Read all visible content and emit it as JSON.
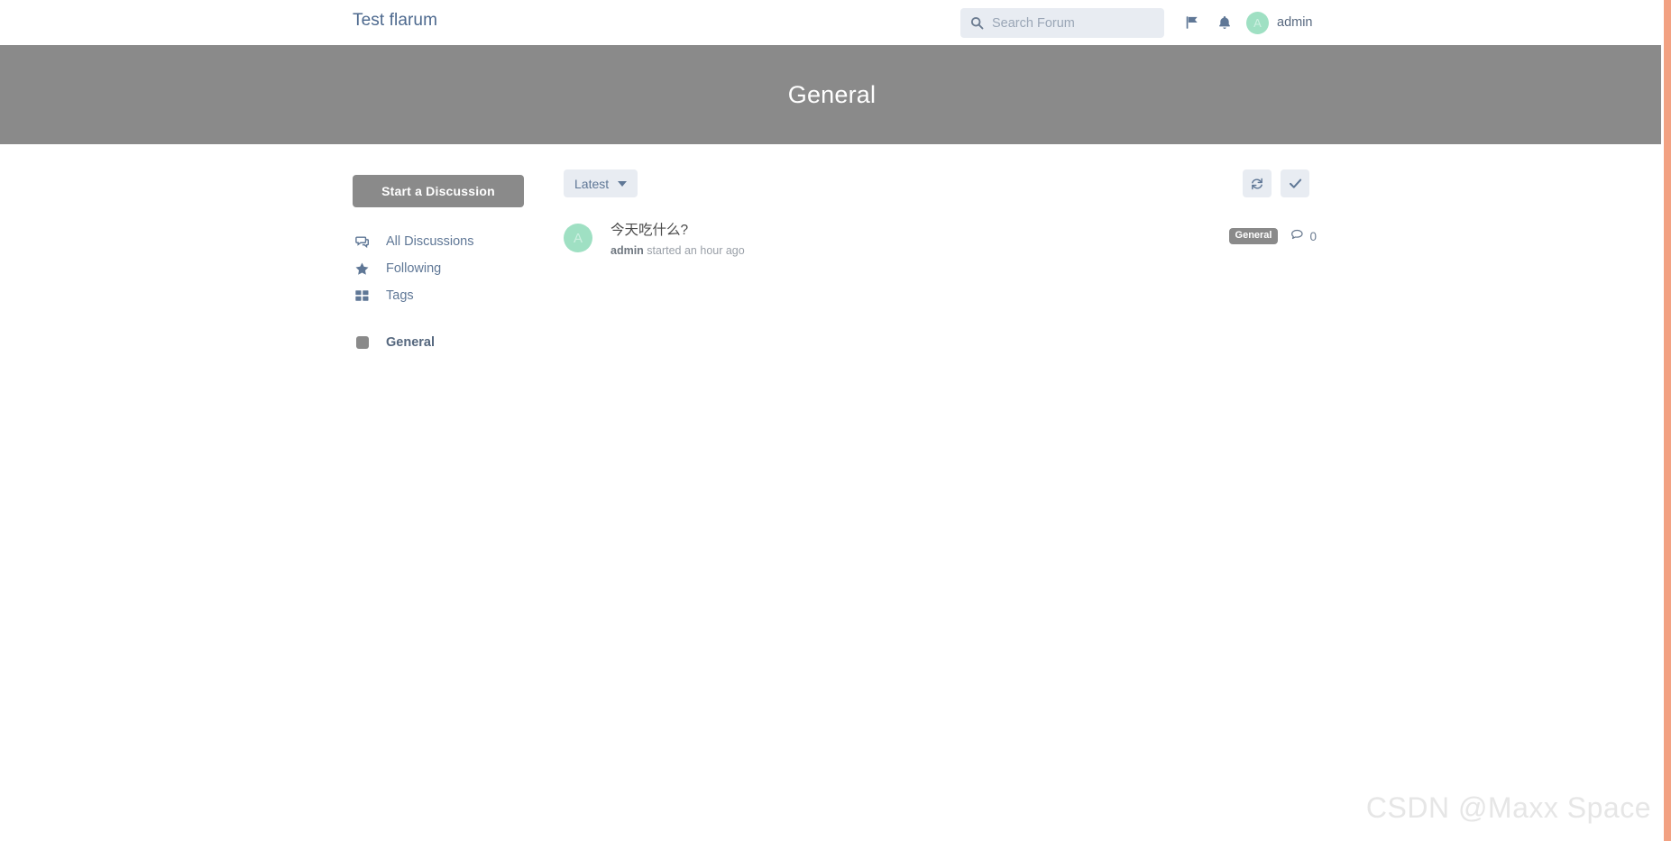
{
  "header": {
    "brand": "Test flarum",
    "search": {
      "placeholder": "Search Forum",
      "value": "",
      "icon": "search-icon"
    },
    "flag_icon": "flag-icon",
    "bell_icon": "bell-icon",
    "user": {
      "name": "admin",
      "avatar_initial": "A",
      "avatar_color": "#9fe0c3"
    }
  },
  "hero": {
    "title": "General",
    "background": "#8a8a8a"
  },
  "sidebar": {
    "start_discussion_label": "Start a Discussion",
    "nav": [
      {
        "label": "All Discussions",
        "icon": "discussions-icon"
      },
      {
        "label": "Following",
        "icon": "star-icon"
      },
      {
        "label": "Tags",
        "icon": "grid-icon"
      }
    ],
    "tags": [
      {
        "label": "General",
        "color": "#8a8a8a",
        "icon": "tag-swatch-icon"
      }
    ]
  },
  "main": {
    "sort": {
      "label": "Latest",
      "caret_icon": "chevron-down-icon"
    },
    "actions": [
      {
        "name": "refresh-button",
        "icon": "refresh-icon"
      },
      {
        "name": "mark-all-read-button",
        "icon": "check-icon"
      }
    ],
    "discussions": [
      {
        "title": "今天吃什么?",
        "author": "admin",
        "meta_suffix": "started an hour ago",
        "avatar_initial": "A",
        "avatar_color": "#9fe0c3",
        "tag": "General",
        "tag_color": "#8a8a8a",
        "comment_count": "0",
        "comment_icon": "comment-icon"
      }
    ]
  },
  "watermark": {
    "text": "CSDN @Maxx Space"
  }
}
